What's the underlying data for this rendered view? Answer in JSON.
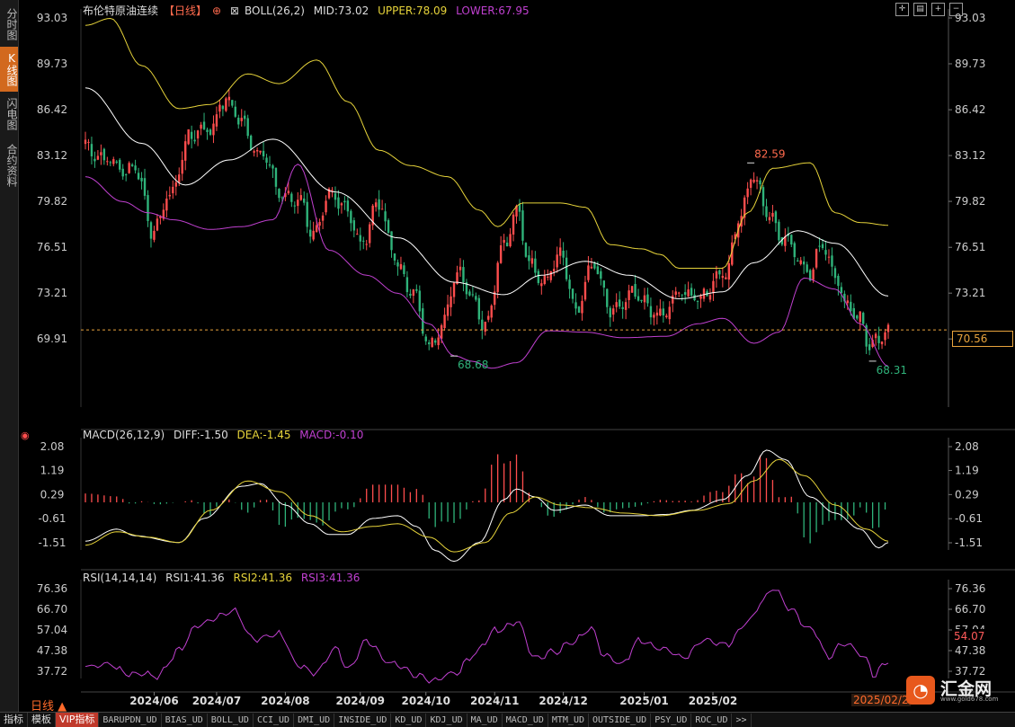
{
  "sidebar": {
    "tabs": [
      {
        "label": "分时图",
        "active": false
      },
      {
        "label": "K线图",
        "active": true
      },
      {
        "label": "闪电图",
        "active": false
      },
      {
        "label": "合约资料",
        "active": false
      }
    ]
  },
  "header": {
    "title": "布伦特原油连续",
    "period": "【日线】",
    "boll_label": "BOLL(26,2)",
    "mid_label": "MID:73.02",
    "upper_label": "UPPER:78.09",
    "lower_label": "LOWER:67.95"
  },
  "macd_legend": {
    "name": "MACD(26,12,9)",
    "diff": "DIFF:-1.50",
    "dea": "DEA:-1.45",
    "macd": "MACD:-0.10"
  },
  "rsi_legend": {
    "name": "RSI(14,14,14)",
    "rsi1": "RSI1:41.36",
    "rsi2": "RSI2:41.36",
    "rsi3": "RSI3:41.36"
  },
  "readouts": {
    "last_price": "70.56",
    "rsi_value": "54.07",
    "date": "2025/02/2",
    "period_button": "日线 ▲"
  },
  "logo": {
    "name": "汇金网",
    "url": "www.gold678.com"
  },
  "toolbar": {
    "items": [
      "指标",
      "模板",
      "VIP指标",
      "BARUPDN_UD",
      "BIAS_UD",
      "BOLL_UD",
      "CCI_UD",
      "DMI_UD",
      "INSIDE_UD",
      "KD_UD",
      "KDJ_UD",
      "MA_UD",
      "MACD_UD",
      "MTM_UD",
      "OUTSIDE_UD",
      "PSY_UD",
      "ROC_UD",
      ">>"
    ]
  },
  "colors": {
    "up": "#ff4d4d",
    "down": "#2fb37a",
    "boll_mid": "#ffffff",
    "boll_upper": "#e6d33a",
    "boll_lower": "#c040d0",
    "dea": "#e6d33a",
    "rsi": "#c040d0",
    "last_price_line": "#e8a33d"
  },
  "chart_data": [
    {
      "type": "candlestick",
      "title": "布伦特原油连续",
      "y_ticks": [
        "93.03",
        "89.73",
        "86.42",
        "83.12",
        "79.82",
        "76.51",
        "73.21",
        "69.91"
      ],
      "ylim": [
        68.0,
        93.03
      ],
      "x_ticks": [
        "2024/06",
        "2024/07",
        "2024/08",
        "2024/09",
        "2024/10",
        "2024/11",
        "2024/12",
        "2025/01",
        "2025/02"
      ],
      "annotations": [
        {
          "text": "68.68",
          "kind": "low"
        },
        {
          "text": "82.59",
          "kind": "high"
        },
        {
          "text": "68.31",
          "kind": "low"
        }
      ],
      "last_price": 70.56,
      "close_anchors": [
        {
          "i": 0,
          "c": 83.6
        },
        {
          "i": 6,
          "c": 83.2
        },
        {
          "i": 12,
          "c": 81.7
        },
        {
          "i": 16,
          "c": 82.6
        },
        {
          "i": 22,
          "c": 77.3
        },
        {
          "i": 27,
          "c": 80.5
        },
        {
          "i": 33,
          "c": 84.2
        },
        {
          "i": 40,
          "c": 85.3
        },
        {
          "i": 44,
          "c": 87.0
        },
        {
          "i": 50,
          "c": 85.6
        },
        {
          "i": 56,
          "c": 83.3
        },
        {
          "i": 62,
          "c": 80.6
        },
        {
          "i": 68,
          "c": 80.0
        },
        {
          "i": 73,
          "c": 77.3
        },
        {
          "i": 78,
          "c": 80.4
        },
        {
          "i": 84,
          "c": 79.0
        },
        {
          "i": 88,
          "c": 77.0
        },
        {
          "i": 94,
          "c": 79.5
        },
        {
          "i": 98,
          "c": 76.5
        },
        {
          "i": 104,
          "c": 73.5
        },
        {
          "i": 110,
          "c": 69.5
        },
        {
          "i": 114,
          "c": 71.2
        },
        {
          "i": 120,
          "c": 74.6
        },
        {
          "i": 124,
          "c": 73.2
        },
        {
          "i": 128,
          "c": 70.6
        },
        {
          "i": 134,
          "c": 77.0
        },
        {
          "i": 138,
          "c": 79.4
        },
        {
          "i": 142,
          "c": 75.0
        },
        {
          "i": 146,
          "c": 74.3
        },
        {
          "i": 152,
          "c": 76.0
        },
        {
          "i": 157,
          "c": 72.0
        },
        {
          "i": 162,
          "c": 75.3
        },
        {
          "i": 168,
          "c": 71.9
        },
        {
          "i": 174,
          "c": 73.0
        },
        {
          "i": 179,
          "c": 72.3
        },
        {
          "i": 185,
          "c": 71.8
        },
        {
          "i": 192,
          "c": 73.3
        },
        {
          "i": 198,
          "c": 73.0
        },
        {
          "i": 204,
          "c": 74.6
        },
        {
          "i": 210,
          "c": 79.0
        },
        {
          "i": 214,
          "c": 81.5
        },
        {
          "i": 218,
          "c": 79.5
        },
        {
          "i": 223,
          "c": 77.1
        },
        {
          "i": 228,
          "c": 76.0
        },
        {
          "i": 232,
          "c": 74.8
        },
        {
          "i": 236,
          "c": 76.5
        },
        {
          "i": 240,
          "c": 74.6
        },
        {
          "i": 244,
          "c": 72.5
        },
        {
          "i": 248,
          "c": 71.0
        },
        {
          "i": 251,
          "c": 69.3
        },
        {
          "i": 254,
          "c": 70.1
        },
        {
          "i": 257,
          "c": 70.56
        }
      ],
      "boll_mid_anchors": [
        {
          "i": 0,
          "v": 88.0
        },
        {
          "i": 18,
          "v": 84.0
        },
        {
          "i": 32,
          "v": 81.0
        },
        {
          "i": 46,
          "v": 82.8
        },
        {
          "i": 60,
          "v": 84.3
        },
        {
          "i": 80,
          "v": 80.5
        },
        {
          "i": 100,
          "v": 77.2
        },
        {
          "i": 118,
          "v": 74.0
        },
        {
          "i": 134,
          "v": 73.1
        },
        {
          "i": 146,
          "v": 74.5
        },
        {
          "i": 160,
          "v": 75.5
        },
        {
          "i": 174,
          "v": 74.5
        },
        {
          "i": 190,
          "v": 72.8
        },
        {
          "i": 204,
          "v": 73.3
        },
        {
          "i": 214,
          "v": 75.4
        },
        {
          "i": 228,
          "v": 77.7
        },
        {
          "i": 240,
          "v": 76.8
        },
        {
          "i": 257,
          "v": 73.0
        }
      ],
      "boll_upper_anchors": [
        {
          "i": 0,
          "v": 92.5
        },
        {
          "i": 8,
          "v": 93.0
        },
        {
          "i": 18,
          "v": 89.6
        },
        {
          "i": 30,
          "v": 86.5
        },
        {
          "i": 40,
          "v": 86.8
        },
        {
          "i": 52,
          "v": 89.0
        },
        {
          "i": 62,
          "v": 88.3
        },
        {
          "i": 74,
          "v": 90.0
        },
        {
          "i": 84,
          "v": 87.0
        },
        {
          "i": 94,
          "v": 83.5
        },
        {
          "i": 104,
          "v": 82.4
        },
        {
          "i": 116,
          "v": 81.6
        },
        {
          "i": 126,
          "v": 79.2
        },
        {
          "i": 132,
          "v": 78.0
        },
        {
          "i": 140,
          "v": 79.7
        },
        {
          "i": 152,
          "v": 79.7
        },
        {
          "i": 160,
          "v": 79.4
        },
        {
          "i": 168,
          "v": 76.7
        },
        {
          "i": 178,
          "v": 76.4
        },
        {
          "i": 184,
          "v": 76.0
        },
        {
          "i": 190,
          "v": 75.0
        },
        {
          "i": 204,
          "v": 75.0
        },
        {
          "i": 212,
          "v": 79.0
        },
        {
          "i": 220,
          "v": 82.2
        },
        {
          "i": 232,
          "v": 82.6
        },
        {
          "i": 240,
          "v": 79.0
        },
        {
          "i": 248,
          "v": 78.3
        },
        {
          "i": 257,
          "v": 78.1
        }
      ],
      "boll_lower_anchors": [
        {
          "i": 0,
          "v": 81.6
        },
        {
          "i": 12,
          "v": 79.8
        },
        {
          "i": 20,
          "v": 79.0
        },
        {
          "i": 28,
          "v": 78.5
        },
        {
          "i": 40,
          "v": 77.8
        },
        {
          "i": 50,
          "v": 78.0
        },
        {
          "i": 60,
          "v": 78.5
        },
        {
          "i": 68,
          "v": 82.5
        },
        {
          "i": 78,
          "v": 76.3
        },
        {
          "i": 90,
          "v": 74.5
        },
        {
          "i": 100,
          "v": 73.2
        },
        {
          "i": 110,
          "v": 71.0
        },
        {
          "i": 118,
          "v": 68.7
        },
        {
          "i": 124,
          "v": 68.3
        },
        {
          "i": 130,
          "v": 67.8
        },
        {
          "i": 138,
          "v": 68.2
        },
        {
          "i": 148,
          "v": 70.5
        },
        {
          "i": 160,
          "v": 70.4
        },
        {
          "i": 172,
          "v": 70.0
        },
        {
          "i": 186,
          "v": 70.1
        },
        {
          "i": 196,
          "v": 71.0
        },
        {
          "i": 204,
          "v": 71.4
        },
        {
          "i": 214,
          "v": 69.6
        },
        {
          "i": 222,
          "v": 70.4
        },
        {
          "i": 230,
          "v": 74.3
        },
        {
          "i": 240,
          "v": 73.5
        },
        {
          "i": 248,
          "v": 71.0
        },
        {
          "i": 257,
          "v": 67.95
        }
      ]
    },
    {
      "type": "line",
      "title": "MACD(26,12,9)",
      "y_ticks": [
        "2.08",
        "1.19",
        "0.29",
        "-0.61",
        "-1.51"
      ],
      "ylim": [
        -2.3,
        2.08
      ],
      "series": [
        {
          "name": "DIFF",
          "anchors": [
            {
              "i": 0,
              "v": -1.45
            },
            {
              "i": 10,
              "v": -1.0
            },
            {
              "i": 16,
              "v": -1.25
            },
            {
              "i": 30,
              "v": -1.5
            },
            {
              "i": 38,
              "v": -0.6
            },
            {
              "i": 50,
              "v": 0.6
            },
            {
              "i": 56,
              "v": 0.7
            },
            {
              "i": 64,
              "v": -0.1
            },
            {
              "i": 72,
              "v": -0.8
            },
            {
              "i": 78,
              "v": -1.2
            },
            {
              "i": 84,
              "v": -1.2
            },
            {
              "i": 92,
              "v": -0.6
            },
            {
              "i": 100,
              "v": -0.5
            },
            {
              "i": 106,
              "v": -0.9
            },
            {
              "i": 112,
              "v": -1.8
            },
            {
              "i": 118,
              "v": -2.2
            },
            {
              "i": 126,
              "v": -1.5
            },
            {
              "i": 134,
              "v": 0.1
            },
            {
              "i": 138,
              "v": 0.5
            },
            {
              "i": 144,
              "v": 0.2
            },
            {
              "i": 150,
              "v": -0.3
            },
            {
              "i": 160,
              "v": -0.1
            },
            {
              "i": 168,
              "v": -0.5
            },
            {
              "i": 178,
              "v": -0.5
            },
            {
              "i": 186,
              "v": -0.45
            },
            {
              "i": 194,
              "v": -0.3
            },
            {
              "i": 204,
              "v": 0.1
            },
            {
              "i": 212,
              "v": 1.0
            },
            {
              "i": 218,
              "v": 1.95
            },
            {
              "i": 224,
              "v": 1.6
            },
            {
              "i": 232,
              "v": 0.2
            },
            {
              "i": 240,
              "v": -0.4
            },
            {
              "i": 248,
              "v": -1.0
            },
            {
              "i": 254,
              "v": -1.7
            },
            {
              "i": 257,
              "v": -1.5
            }
          ]
        },
        {
          "name": "DEA",
          "anchors": [
            {
              "i": 0,
              "v": -1.6
            },
            {
              "i": 10,
              "v": -1.1
            },
            {
              "i": 20,
              "v": -1.3
            },
            {
              "i": 30,
              "v": -1.5
            },
            {
              "i": 40,
              "v": -0.3
            },
            {
              "i": 52,
              "v": 0.8
            },
            {
              "i": 62,
              "v": 0.4
            },
            {
              "i": 72,
              "v": -0.5
            },
            {
              "i": 82,
              "v": -1.1
            },
            {
              "i": 92,
              "v": -0.9
            },
            {
              "i": 100,
              "v": -0.8
            },
            {
              "i": 110,
              "v": -1.3
            },
            {
              "i": 118,
              "v": -1.85
            },
            {
              "i": 128,
              "v": -1.5
            },
            {
              "i": 136,
              "v": -0.4
            },
            {
              "i": 144,
              "v": 0.2
            },
            {
              "i": 152,
              "v": -0.1
            },
            {
              "i": 162,
              "v": -0.2
            },
            {
              "i": 172,
              "v": -0.4
            },
            {
              "i": 184,
              "v": -0.5
            },
            {
              "i": 196,
              "v": -0.3
            },
            {
              "i": 206,
              "v": -0.05
            },
            {
              "i": 214,
              "v": 0.8
            },
            {
              "i": 222,
              "v": 1.6
            },
            {
              "i": 230,
              "v": 1.0
            },
            {
              "i": 240,
              "v": -0.1
            },
            {
              "i": 250,
              "v": -1.0
            },
            {
              "i": 257,
              "v": -1.45
            }
          ]
        },
        {
          "name": "MACD",
          "rule": "DIFF minus DEA, drawn as histogram"
        }
      ]
    },
    {
      "type": "line",
      "title": "RSI(14,14,14)",
      "y_ticks": [
        "76.36",
        "66.70",
        "57.04",
        "47.38",
        "37.72"
      ],
      "ylim": [
        32.0,
        76.36
      ],
      "series": [
        {
          "name": "RSI1",
          "anchors": [
            {
              "i": 0,
              "v": 41.0
            },
            {
              "i": 8,
              "v": 40.0
            },
            {
              "i": 14,
              "v": 37.0
            },
            {
              "i": 22,
              "v": 35.0
            },
            {
              "i": 30,
              "v": 47.0
            },
            {
              "i": 36,
              "v": 60.0
            },
            {
              "i": 42,
              "v": 62.0
            },
            {
              "i": 48,
              "v": 66.0
            },
            {
              "i": 54,
              "v": 52.0
            },
            {
              "i": 62,
              "v": 56.0
            },
            {
              "i": 68,
              "v": 40.0
            },
            {
              "i": 74,
              "v": 38.0
            },
            {
              "i": 80,
              "v": 48.0
            },
            {
              "i": 84,
              "v": 40.0
            },
            {
              "i": 90,
              "v": 51.0
            },
            {
              "i": 98,
              "v": 42.0
            },
            {
              "i": 106,
              "v": 36.0
            },
            {
              "i": 112,
              "v": 33.0
            },
            {
              "i": 118,
              "v": 37.0
            },
            {
              "i": 124,
              "v": 45.0
            },
            {
              "i": 132,
              "v": 58.0
            },
            {
              "i": 138,
              "v": 60.0
            },
            {
              "i": 144,
              "v": 45.0
            },
            {
              "i": 150,
              "v": 46.0
            },
            {
              "i": 156,
              "v": 52.0
            },
            {
              "i": 162,
              "v": 57.0
            },
            {
              "i": 166,
              "v": 46.0
            },
            {
              "i": 172,
              "v": 41.0
            },
            {
              "i": 178,
              "v": 53.0
            },
            {
              "i": 184,
              "v": 48.0
            },
            {
              "i": 192,
              "v": 45.0
            },
            {
              "i": 198,
              "v": 52.0
            },
            {
              "i": 206,
              "v": 51.0
            },
            {
              "i": 212,
              "v": 60.0
            },
            {
              "i": 216,
              "v": 70.0
            },
            {
              "i": 220,
              "v": 76.0
            },
            {
              "i": 226,
              "v": 67.0
            },
            {
              "i": 232,
              "v": 57.0
            },
            {
              "i": 238,
              "v": 45.0
            },
            {
              "i": 242,
              "v": 51.0
            },
            {
              "i": 246,
              "v": 48.0
            },
            {
              "i": 250,
              "v": 44.0
            },
            {
              "i": 253,
              "v": 35.0
            },
            {
              "i": 255,
              "v": 40.0
            },
            {
              "i": 257,
              "v": 41.36
            }
          ]
        }
      ]
    }
  ]
}
